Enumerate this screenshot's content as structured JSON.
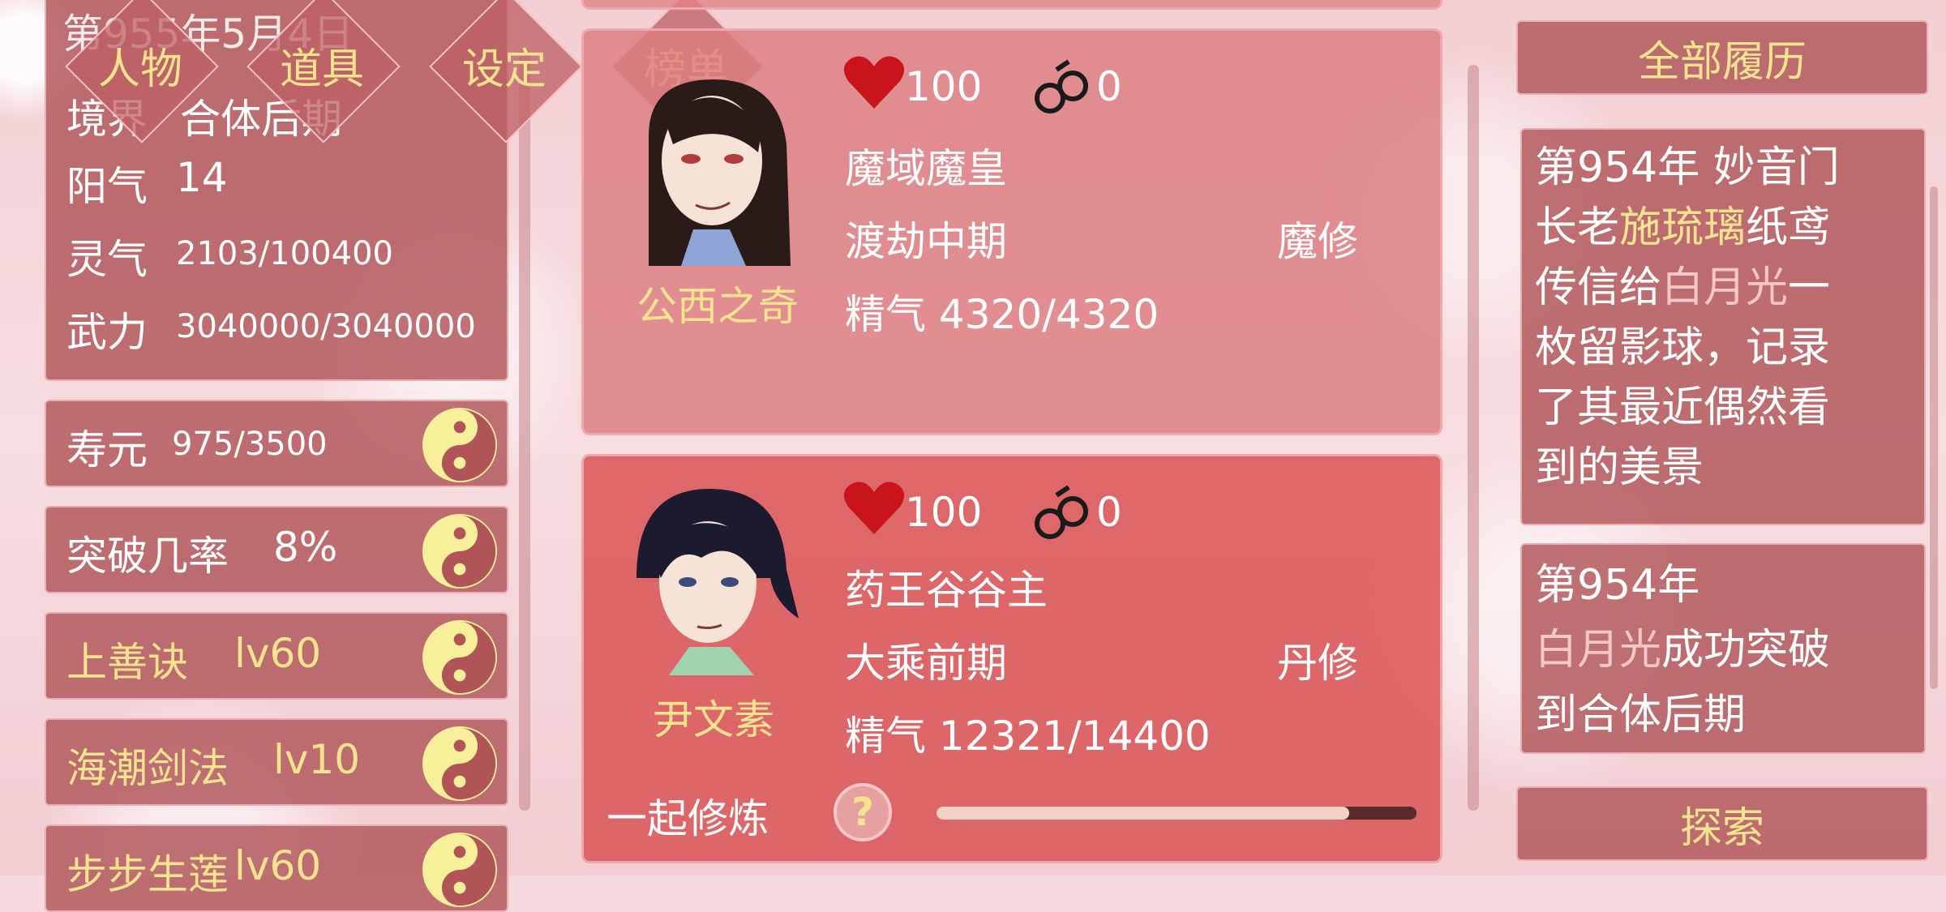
{
  "left": {
    "date_partial": "第955年5月4日",
    "realm_label": "境界",
    "realm_value": "合体后期",
    "yang_label": "阳气",
    "yang_value": "14",
    "qi_label": "灵气",
    "qi_value": "2103/100400",
    "power_label": "武力",
    "power_value": "3040000/3040000",
    "list": [
      {
        "label": "寿元",
        "value": "975/3500",
        "gold": false
      },
      {
        "label": "突破几率",
        "value": "8%",
        "gold": false
      },
      {
        "label": "上善诀",
        "value": "lv60",
        "gold": true
      },
      {
        "label": "海潮剑法",
        "value": "lv10",
        "gold": true
      },
      {
        "label": "步步生莲",
        "value": "lv60",
        "gold": true
      }
    ]
  },
  "tabs": [
    "人物",
    "道具",
    "设定",
    "榜单"
  ],
  "cards": [
    {
      "name": "公西之奇",
      "heart": "100",
      "cuffs": "0",
      "title": "魔域魔皇",
      "realm": "渡劫中期",
      "school": "魔修",
      "essence": "精气 4320/4320"
    },
    {
      "name": "尹文素",
      "heart": "100",
      "cuffs": "0",
      "title": "药王谷谷主",
      "realm": "大乘前期",
      "school": "丹修",
      "essence": "精气 12321/14400",
      "train_label": "一起修炼",
      "train_progress": 0.86
    }
  ],
  "right": {
    "header": "全部履历",
    "event1": {
      "l1": "第954年 妙音门",
      "l2a": "长老",
      "l2b": "施琉璃",
      "l2c": "纸鸢",
      "l3a": "传信给",
      "l3b": "白月光",
      "l3c": "一",
      "l4": "枚留影球，记录",
      "l5": "了其最近偶然看",
      "l6": "到的美景"
    },
    "event2": {
      "l1": "第954年",
      "l2a": "白月光",
      "l2b": "成功突破",
      "l3": "到合体后期"
    },
    "explore": "探索"
  },
  "colors": {
    "panel": "#b05458",
    "gold": "#f6e38f",
    "pink_name": "#f6c6c9",
    "heart": "#c8141a"
  }
}
